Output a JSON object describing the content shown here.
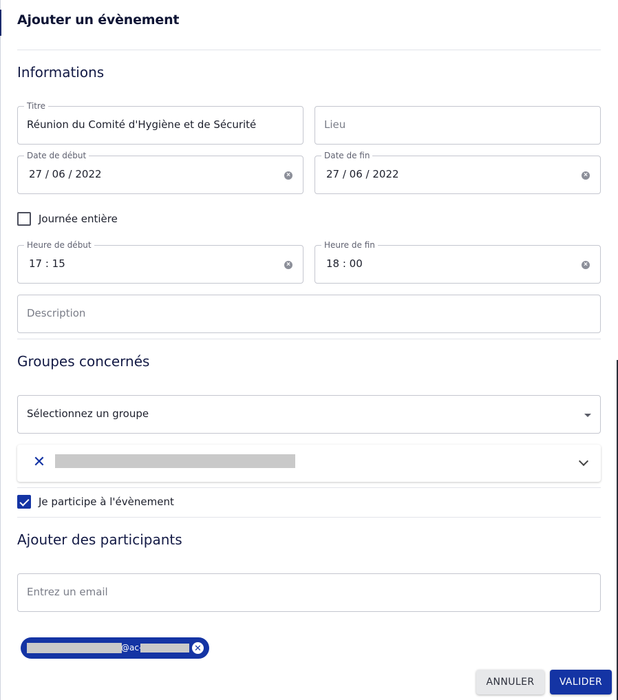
{
  "dialog": {
    "title": "Ajouter un évènement"
  },
  "informations": {
    "section_title": "Informations",
    "titre": {
      "label": "Titre",
      "value": "Réunion du Comité d'Hygiène et de Sécurité"
    },
    "lieu": {
      "placeholder": "Lieu"
    },
    "date_debut": {
      "label": "Date de début",
      "value": "27 / 06 / 2022"
    },
    "date_fin": {
      "label": "Date de fin",
      "value": "27 / 06 / 2022"
    },
    "journee_entiere": {
      "label": "Journée entière",
      "checked": false
    },
    "heure_debut": {
      "label": "Heure de début",
      "value": "17 : 15"
    },
    "heure_fin": {
      "label": "Heure de fin",
      "value": "18 : 00"
    },
    "description": {
      "placeholder": "Description"
    }
  },
  "groupes": {
    "section_title": "Groupes concernés",
    "select_placeholder": "Sélectionnez un groupe",
    "remove_icon": "✕"
  },
  "participation": {
    "label": "Je participe à l'évènement",
    "checked": true
  },
  "participants": {
    "section_title": "Ajouter des participants",
    "email_placeholder": "Entrez un email",
    "chip_fragment": "@ac-",
    "chip_delete_icon": "✕"
  },
  "actions": {
    "cancel_label": "ANNULER",
    "submit_label": "VALIDER"
  },
  "colors": {
    "primary": "#1434a4",
    "title": "#0f1535",
    "border": "#c4c6cf"
  }
}
